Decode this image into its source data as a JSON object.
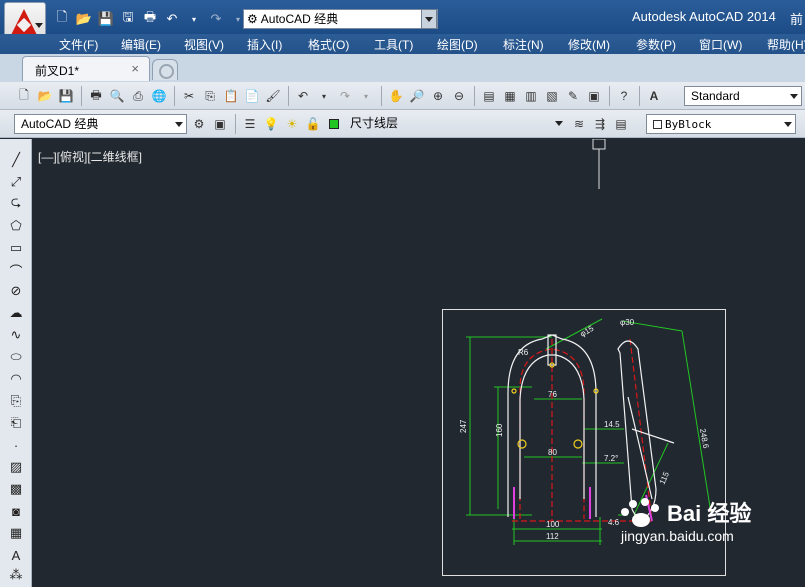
{
  "titlebar": {
    "workspace": "AutoCAD 经典",
    "app_title": "Autodesk AutoCAD 2014",
    "title_cut": "前"
  },
  "menu": [
    "文件(F)",
    "编辑(E)",
    "视图(V)",
    "插入(I)",
    "格式(O)",
    "工具(T)",
    "绘图(D)",
    "标注(N)",
    "修改(M)",
    "参数(P)",
    "窗口(W)",
    "帮助(H)"
  ],
  "doc_tab": {
    "label": "前叉D1*",
    "close": "×"
  },
  "toolbar1": {
    "text_style": "Standard"
  },
  "toolbar2": {
    "workspace": "AutoCAD 经典",
    "layer": "尺寸线层",
    "color": "ByBlock"
  },
  "viewport": {
    "label": "[—][俯视][二维线框]"
  },
  "drawing": {
    "dims": [
      "φ15",
      "R6",
      "76",
      "247",
      "160",
      "14.5",
      "80",
      "7.2°",
      "100",
      "112",
      "4.6",
      "φ30",
      "248.6",
      "115"
    ]
  },
  "watermark": {
    "brand": "Bai 经验",
    "url": "jingyan.baidu.com"
  },
  "colors": {
    "accent": "#d11a12",
    "canvas": "#212830",
    "dim": "#22c522",
    "outline": "#f2f2f2",
    "center": "#d81818"
  }
}
